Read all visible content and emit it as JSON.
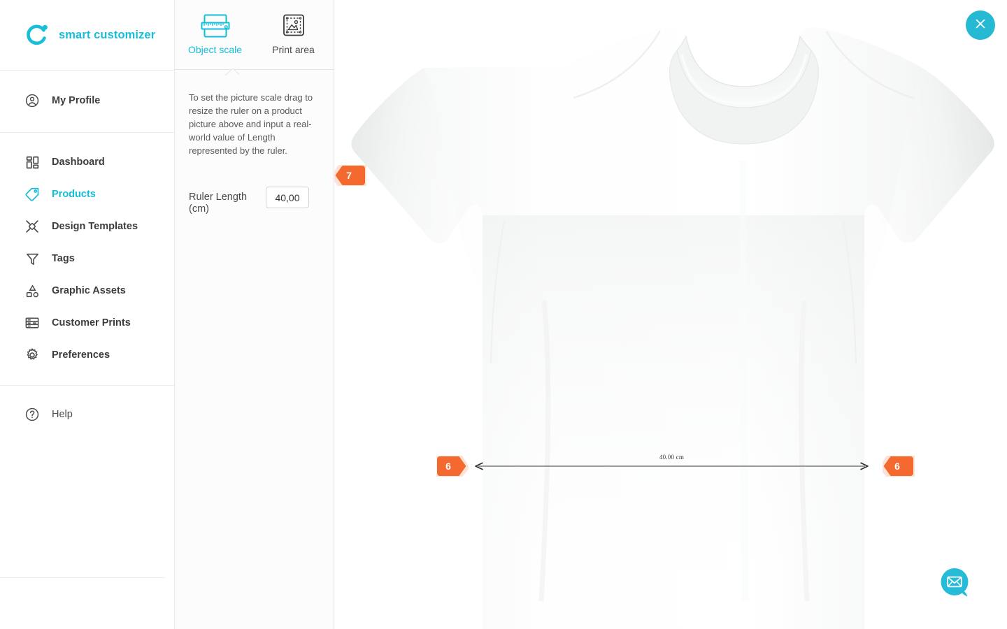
{
  "brand": {
    "name": "smart customizer",
    "logo_icon": "circle-dot-logo-icon",
    "accent_color": "#18bed8"
  },
  "sidebar": {
    "profile": [
      {
        "label": "My Profile",
        "icon": "user-circle-icon",
        "active": false
      }
    ],
    "items": [
      {
        "label": "Dashboard",
        "icon": "dashboard-grid-icon",
        "active": false
      },
      {
        "label": "Products",
        "icon": "tag-icon",
        "active": true
      },
      {
        "label": "Design Templates",
        "icon": "design-templates-icon",
        "active": false
      },
      {
        "label": "Tags",
        "icon": "funnel-icon",
        "active": false
      },
      {
        "label": "Graphic Assets",
        "icon": "shapes-icon",
        "active": false
      },
      {
        "label": "Customer Prints",
        "icon": "prints-icon",
        "active": false
      },
      {
        "label": "Preferences",
        "icon": "gear-icon",
        "active": false
      }
    ],
    "help": [
      {
        "label": "Help",
        "icon": "question-circle-icon",
        "active": false
      }
    ]
  },
  "panel": {
    "tabs": [
      {
        "label": "Object scale",
        "icon": "ruler-scale-icon",
        "active": true
      },
      {
        "label": "Print area",
        "icon": "print-area-image-icon",
        "active": false
      }
    ],
    "description": "To set the picture scale drag to resize the ruler on a product picture above and input a real-world value of Length represented by the ruler.",
    "field": {
      "label": "Ruler Length (cm)",
      "value": "40,00",
      "placeholder": "40,00"
    }
  },
  "canvas": {
    "product": "white-tshirt-front",
    "ruler": {
      "measure_label": "40.00 cm",
      "handle_badge": "6"
    },
    "badges": [
      {
        "id": "6",
        "position": "ruler-left-handle",
        "direction": "right"
      },
      {
        "id": "6",
        "position": "ruler-right-handle",
        "direction": "left"
      },
      {
        "id": "7",
        "position": "ruler-length-input",
        "direction": "left"
      }
    ],
    "badge_color": "#f4692f"
  },
  "controls": {
    "close": {
      "icon": "close-icon",
      "label": "Close"
    },
    "chat": {
      "icon": "envelope-chat-icon",
      "label": "Messages"
    }
  }
}
